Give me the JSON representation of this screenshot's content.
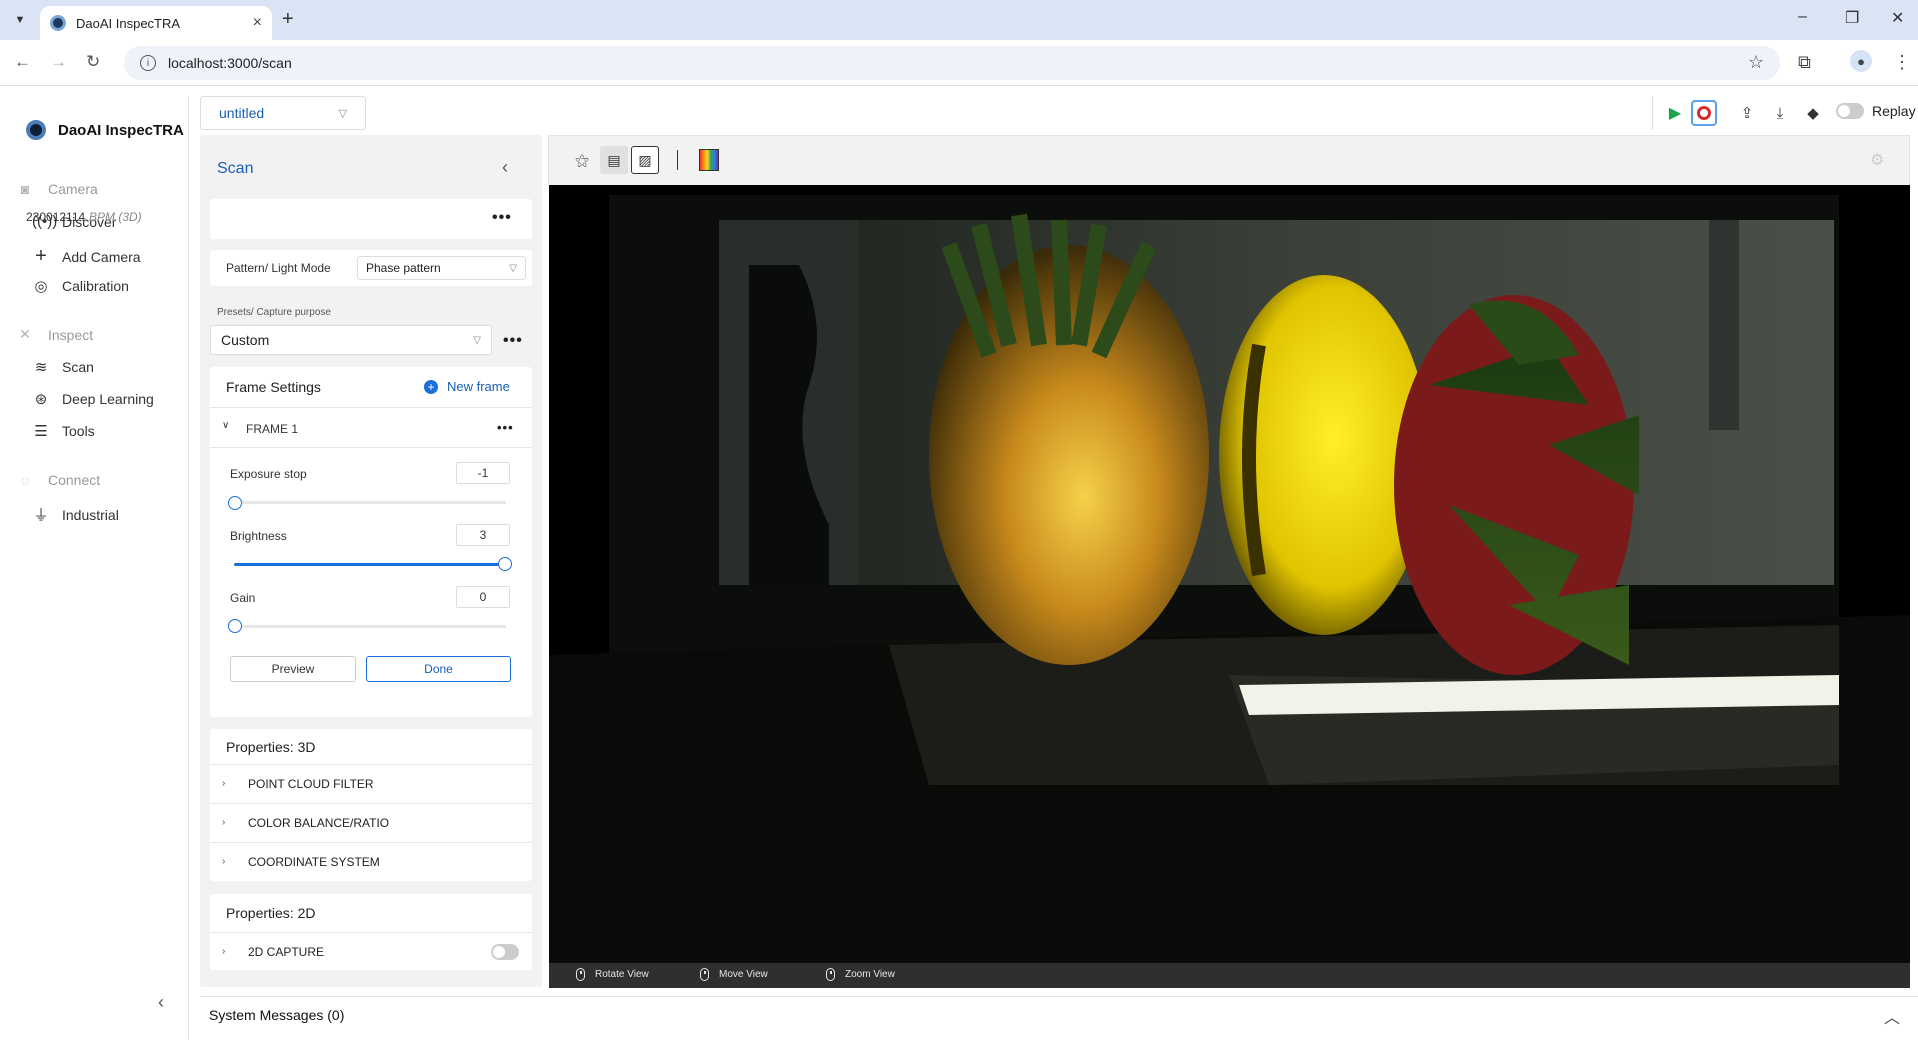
{
  "browser": {
    "tab_title": "DaoAI InspecTRA",
    "url": "localhost:3000/scan"
  },
  "app": {
    "name": "DaoAI InspecTRA",
    "project": "untitled",
    "replay_label": "Replay"
  },
  "sidebar": {
    "sections": [
      {
        "label": "Camera",
        "icon": "camera-icon",
        "items": [
          {
            "label": "Discover",
            "icon": "broadcast-icon"
          },
          {
            "label": "Add Camera",
            "icon": "plus-icon"
          },
          {
            "label": "Calibration",
            "icon": "target-icon"
          }
        ]
      },
      {
        "label": "Inspect",
        "icon": "tools-icon",
        "items": [
          {
            "label": "Scan",
            "icon": "layers-icon"
          },
          {
            "label": "Deep Learning",
            "icon": "brain-icon"
          },
          {
            "label": "Tools",
            "icon": "sliders-icon"
          }
        ]
      },
      {
        "label": "Connect",
        "icon": "link-icon",
        "items": [
          {
            "label": "Industrial",
            "icon": "plug-icon"
          }
        ]
      }
    ]
  },
  "scan_panel": {
    "title": "Scan",
    "camera_id": "230012114",
    "camera_model": "BPM (3D)",
    "pattern_label": "Pattern/ Light Mode",
    "pattern_value": "Phase pattern",
    "presets_label": "Presets/ Capture purpose",
    "presets_value": "Custom",
    "frame_settings_label": "Frame Settings",
    "new_frame_label": "New frame",
    "frame_name": "FRAME 1",
    "exposure_label": "Exposure stop",
    "exposure_value": "-1",
    "exposure_level": 0,
    "brightness_label": "Brightness",
    "brightness_value": "3",
    "brightness_level": 1,
    "gain_label": "Gain",
    "gain_value": "0",
    "gain_level": 0,
    "preview_label": "Preview",
    "done_label": "Done",
    "props3d_label": "Properties: 3D",
    "props3d_items": [
      "POINT CLOUD FILTER",
      "COLOR BALANCE/RATIO",
      "COORDINATE SYSTEM"
    ],
    "props2d_label": "Properties: 2D",
    "capture2d_label": "2D CAPTURE"
  },
  "viewer": {
    "rotate_label": "Rotate View",
    "move_label": "Move View",
    "zoom_label": "Zoom View"
  },
  "system_messages": "System Messages (0)",
  "colors": {
    "accent": "#1a6fd8",
    "record": "#d62d2d",
    "play": "#1aa34a"
  }
}
